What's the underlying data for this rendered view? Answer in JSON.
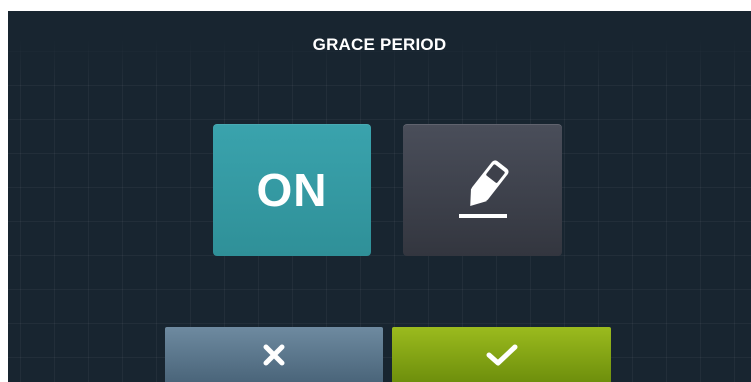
{
  "screen": {
    "title": "GRACE PERIOD"
  },
  "value_tile": {
    "label": "ON",
    "color": "#339aa3"
  },
  "edit_tile": {
    "icon": "edit-pencil-icon",
    "color": "#3e414b"
  },
  "footer": {
    "cancel": {
      "icon": "close-x-icon",
      "color": "#5b778c"
    },
    "confirm": {
      "icon": "checkmark-icon",
      "color": "#86a815"
    }
  }
}
